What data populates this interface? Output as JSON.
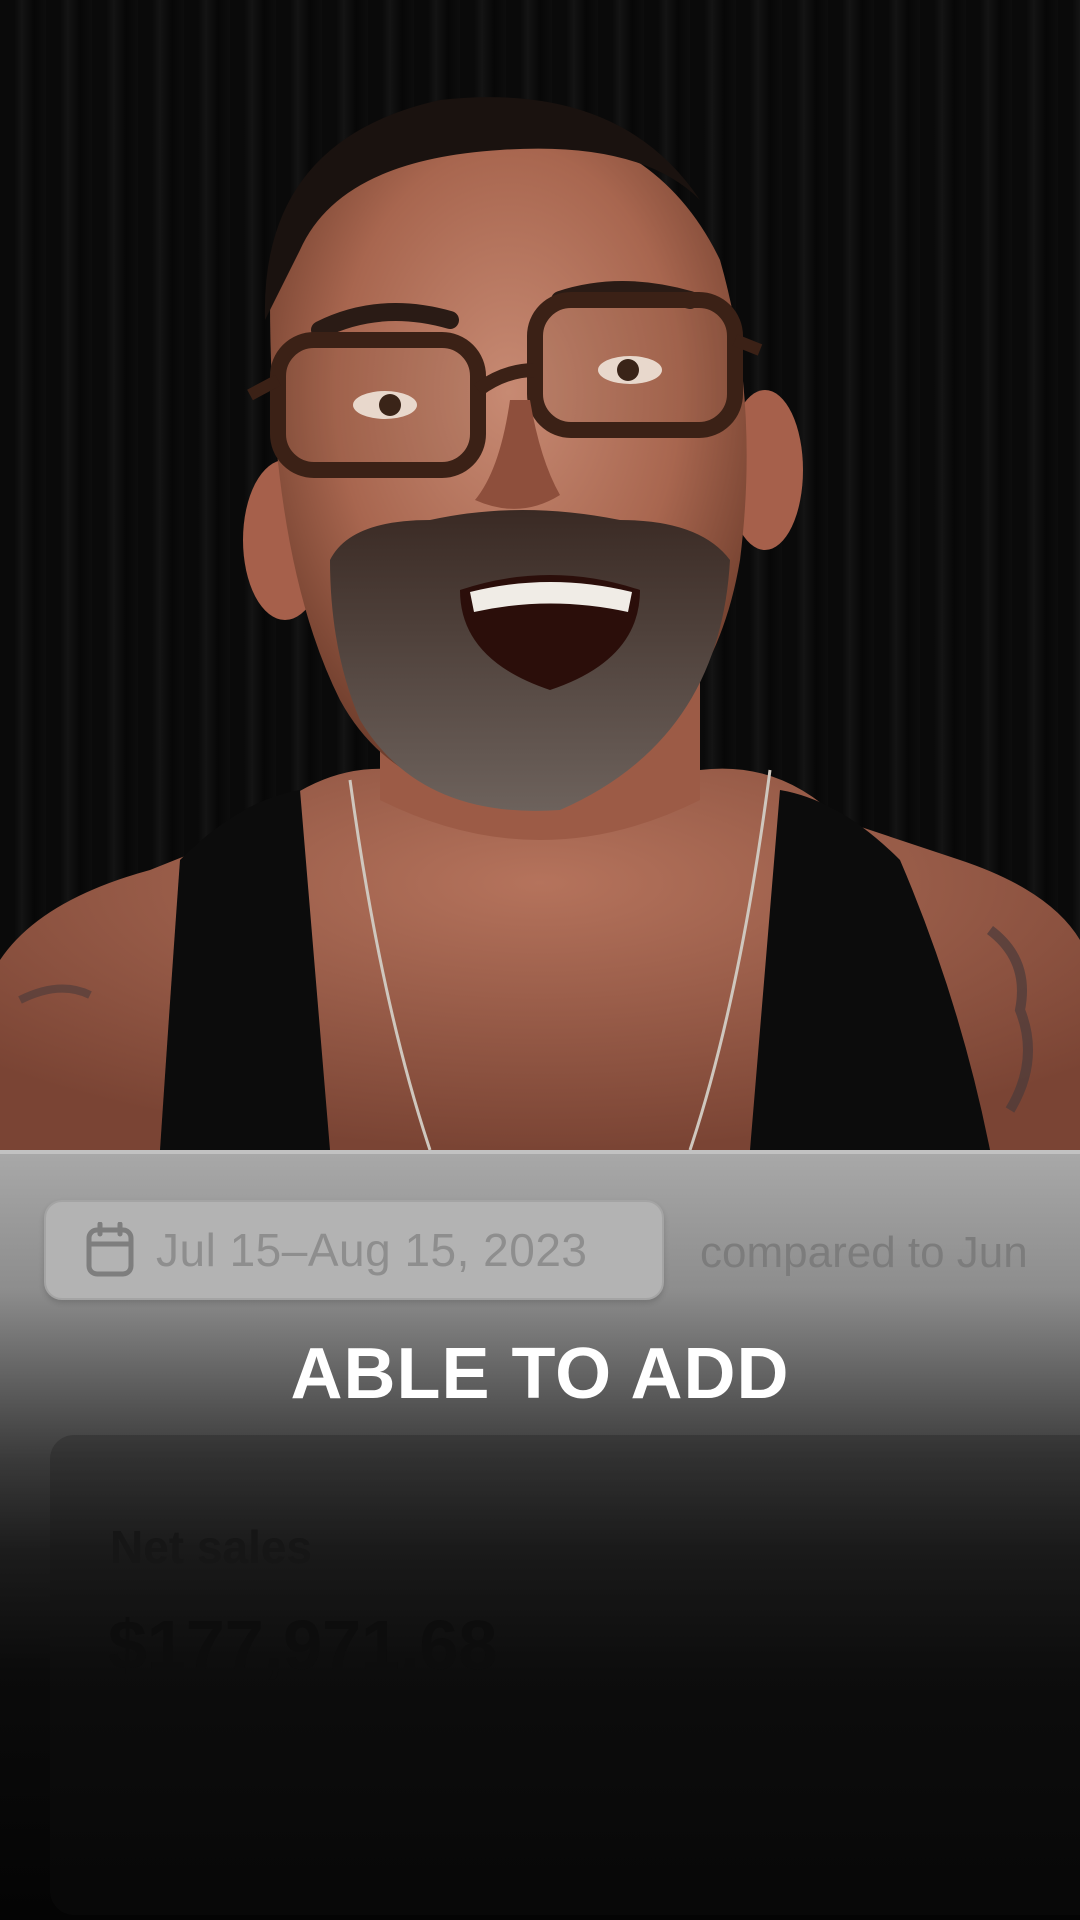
{
  "video": {
    "subject": "presenter-video-frame"
  },
  "analytics": {
    "date_range": "Jul 15–Aug 15, 2023",
    "comparison": "compared to Jun",
    "metric_label": "Net sales",
    "metric_value": "$177,971.68"
  },
  "caption": {
    "text": "ABLE TO ADD"
  },
  "colors": {
    "panel_top": "#a9a9a9",
    "panel_bottom": "#040404",
    "caption": "#ffffff"
  },
  "icons": {
    "calendar": "calendar-icon"
  }
}
